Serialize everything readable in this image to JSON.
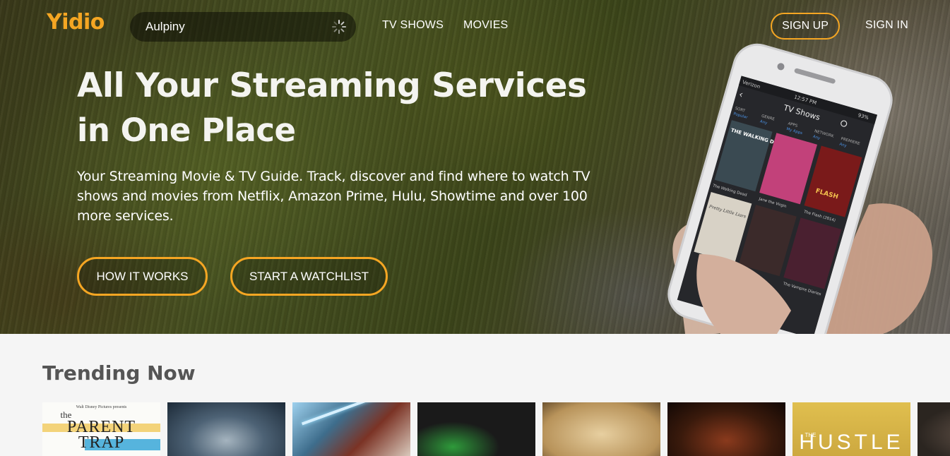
{
  "brand": {
    "logo_text": "Yidio",
    "accent_color": "#f5a623"
  },
  "header": {
    "search_value": "Aulpiny",
    "nav": [
      {
        "label": "TV SHOWS"
      },
      {
        "label": "MOVIES"
      }
    ],
    "sign_up_label": "SIGN UP",
    "sign_in_label": "SIGN IN"
  },
  "hero": {
    "headline": "All Your Streaming Services",
    "subheadline": "in One Place",
    "description": "Your Streaming Movie & TV Guide. Track, discover and find where to watch TV shows and movies from Netflix, Amazon Prime, Hulu, Showtime and over 100 more services.",
    "buttons": [
      {
        "label": "HOW IT WORKS"
      },
      {
        "label": "START A WATCHLIST"
      }
    ]
  },
  "phone": {
    "carrier": "Verizon",
    "time": "12:57 PM",
    "battery": "93%",
    "screen_title": "TV Shows",
    "filters": [
      {
        "label": "SORT",
        "value": "Popular"
      },
      {
        "label": "GENRE",
        "value": "Any"
      },
      {
        "label": "APPS",
        "value": "My Apps"
      },
      {
        "label": "NETWORK",
        "value": "Any"
      },
      {
        "label": "PREMIERE",
        "value": "Any"
      }
    ],
    "shows": [
      {
        "title": "The Walking Dead",
        "poster_text": "THE WALKING DEAD"
      },
      {
        "title": "Jane the Virgin",
        "poster_text": ""
      },
      {
        "title": "The Flash (2014)",
        "poster_text": "FLASH"
      },
      {
        "title": "",
        "poster_text": "Pretty Little Liars"
      },
      {
        "title": "",
        "poster_text": ""
      },
      {
        "title": "The Vampire Diaries",
        "poster_text": ""
      }
    ]
  },
  "trending": {
    "title": "Trending Now",
    "posters": [
      {
        "name": "the-parent-trap",
        "studio": "Walt Disney Pictures presents",
        "lines": [
          "the",
          "PARENT",
          "TRAP"
        ]
      },
      {
        "name": "trending-poster-2",
        "lines": []
      },
      {
        "name": "trending-poster-3",
        "lines": []
      },
      {
        "name": "trending-poster-4",
        "lines": []
      },
      {
        "name": "trending-poster-5",
        "lines": []
      },
      {
        "name": "trending-poster-6",
        "lines": []
      },
      {
        "name": "the-hustle",
        "lines": [
          "THE",
          "HUSTLE"
        ]
      },
      {
        "name": "trending-poster-8",
        "lines": []
      }
    ]
  }
}
